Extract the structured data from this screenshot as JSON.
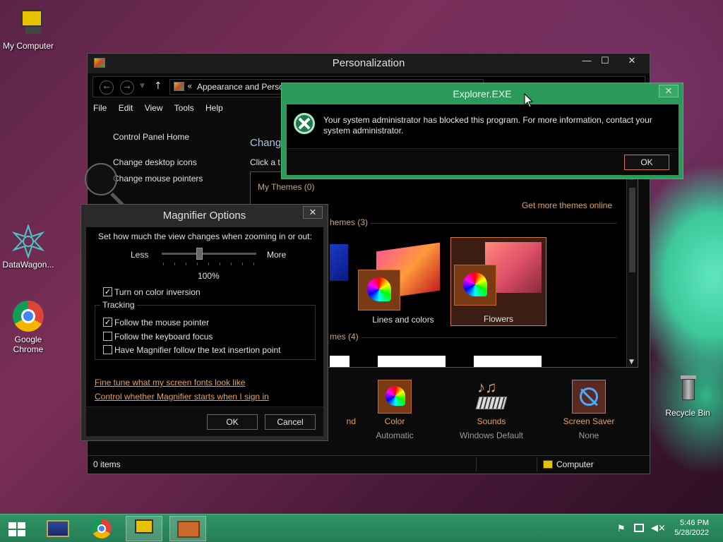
{
  "desktop": {
    "icons": [
      {
        "label": "My Computer"
      },
      {
        "label": "DataWagon..."
      },
      {
        "label": "Google Chrome"
      },
      {
        "label": "Recycle Bin"
      }
    ]
  },
  "personalization": {
    "title": "Personalization",
    "address": "Appearance and Perso",
    "address_prefix": "«",
    "menu": [
      "File",
      "Edit",
      "View",
      "Tools",
      "Help"
    ],
    "sidebar": [
      "Control Panel Home",
      "Change desktop icons",
      "Change mouse pointers"
    ],
    "heading": "Chang",
    "subtext": "Click a t",
    "my_themes": "My Themes (0)",
    "installed_themes": "hemes (3)",
    "hc_themes": "mes (4)",
    "get_more": "Get more themes online",
    "themes": [
      {
        "label": "Lines and colors"
      },
      {
        "label": "Flowers"
      }
    ],
    "bottom": [
      {
        "label": "nd",
        "sub": ""
      },
      {
        "label": "Color",
        "sub": "Automatic"
      },
      {
        "label": "Sounds",
        "sub": "Windows Default"
      },
      {
        "label": "Screen Saver",
        "sub": "None"
      }
    ],
    "status_items": "0 items",
    "status_location": "Computer"
  },
  "explorer": {
    "title": "Explorer.EXE",
    "message": "Your system administrator has blocked this program. For more information, contact your system administrator.",
    "ok": "OK"
  },
  "magnifier": {
    "title": "Magnifier Options",
    "instruction": "Set how much the view changes when zooming in or out:",
    "less": "Less",
    "more": "More",
    "zoom": "100%",
    "color_inversion": "Turn on color inversion",
    "tracking_label": "Tracking",
    "follow_mouse": "Follow the mouse pointer",
    "follow_keyboard": "Follow the keyboard focus",
    "follow_text": "Have Magnifier follow the text insertion point",
    "link_fonts": "Fine tune what my screen fonts look like",
    "link_signin": "Control whether Magnifier starts when I sign in",
    "ok": "OK",
    "cancel": "Cancel"
  },
  "taskbar": {
    "time": "5:46 PM",
    "date": "5/28/2022"
  }
}
